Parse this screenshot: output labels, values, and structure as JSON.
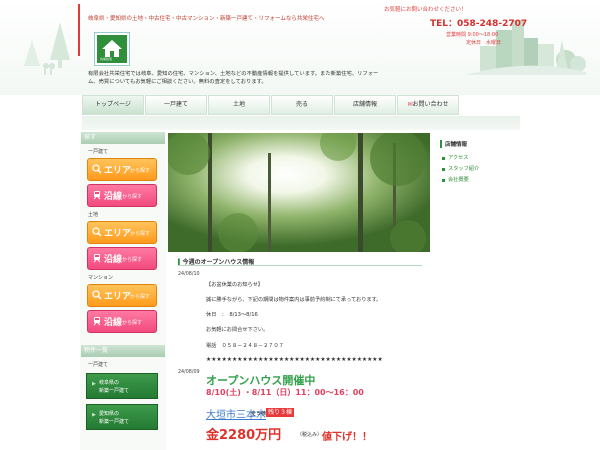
{
  "header": {
    "tagline": "岐阜県・愛知県の土地・中古住宅・中古マンション・新築一戸建て・リフォームなら共栄住宅へ",
    "contact_link": "お気軽にお問い合わせください！",
    "tel": "TEL：058-248-2707",
    "hours_label": "営業時間",
    "hours": "9:00～18:00",
    "closed": "定休日　水曜日",
    "logo_text": "共栄住宅",
    "description": "有限会社共栄住宅では岐阜、愛知の住宅、マンション、土地などの不動産情報を提供しています。また新築住宅、リフォーム、売買についてもお気軽にご相談ください。無料の査定をしております。"
  },
  "nav": [
    {
      "label": "トップページ"
    },
    {
      "label": "一戸建て"
    },
    {
      "label": "土地"
    },
    {
      "label": "売る"
    },
    {
      "label": "店舗情報"
    },
    {
      "label": "お問い合わせ"
    }
  ],
  "sidebar": {
    "head1": "探す",
    "cat_house": "一戸建て",
    "cat_land": "土地",
    "cat_mansion": "マンション",
    "area_big": "エリア",
    "area_small": "から探す",
    "line_big": "沿線",
    "line_small": "から探す",
    "head2": "物件一覧",
    "list_cat": "一戸建て",
    "green1_line1": "岐阜県の",
    "green1_line2": "新築一戸建て",
    "green2_line1": "愛知県の",
    "green2_line2": "新築一戸建て"
  },
  "main": {
    "section_title": "今週のオープンハウス情報",
    "entry1": {
      "date": "24/08/10",
      "lines": [
        "【お盆休業のお知らせ】",
        "誠に勝手ながら、下記の期間は物件案内は事前予約制にて承っております。",
        "休日　：　8/13～8/16",
        "お気軽にお問合せ下さい。",
        "電話　０５８－２４８－２７０７",
        "★★★★★★★★★★★★★★★★★★★★★★★★★★★★★★★★★★"
      ]
    },
    "entry2": {
      "date": "24/08/09",
      "title": "オープンハウス開催中",
      "dates": "8/10(土) ・8/11（日）11：00～16：00",
      "address": "大垣市三本木",
      "units": "全５棟",
      "badge": "残り３棟",
      "price": "金2280万円",
      "tax": "（税込み）",
      "discount": "値下げ！！"
    }
  },
  "right": {
    "head": "店舗情報",
    "links": [
      "アクセス",
      "スタッフ紹介",
      "会社概要"
    ]
  }
}
